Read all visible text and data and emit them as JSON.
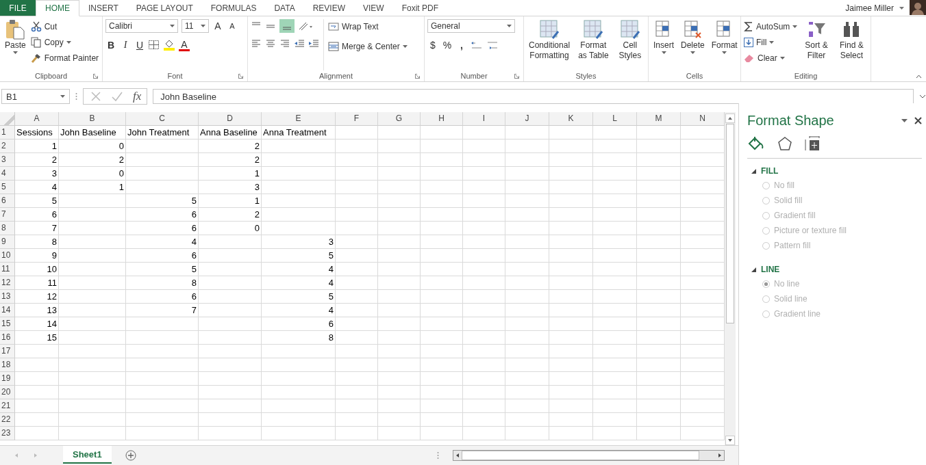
{
  "tabs": [
    {
      "label": "FILE",
      "kind": "file"
    },
    {
      "label": "HOME",
      "kind": "tab",
      "selected": true
    },
    {
      "label": "INSERT",
      "kind": "tab",
      "selected": false
    },
    {
      "label": "PAGE LAYOUT",
      "kind": "tab",
      "selected": false
    },
    {
      "label": "FORMULAS",
      "kind": "tab",
      "selected": false
    },
    {
      "label": "DATA",
      "kind": "tab",
      "selected": false
    },
    {
      "label": "REVIEW",
      "kind": "tab",
      "selected": false
    },
    {
      "label": "VIEW",
      "kind": "tab",
      "selected": false
    },
    {
      "label": "Foxit PDF",
      "kind": "tab",
      "selected": false
    }
  ],
  "user": "Jaimee Miller",
  "ribbon": {
    "clipboard": {
      "label": "Clipboard",
      "paste": "Paste",
      "cut": "Cut",
      "copy": "Copy",
      "format_painter": "Format Painter"
    },
    "font": {
      "label": "Font",
      "family": "Calibri",
      "size": "11",
      "grow": "A",
      "shrink": "A",
      "bold": "B",
      "italic": "I",
      "underline": "U",
      "font_color_letter": "A"
    },
    "alignment": {
      "label": "Alignment",
      "wrap": "Wrap Text",
      "merge": "Merge & Center"
    },
    "number": {
      "label": "Number",
      "format": "General",
      "currency": "$",
      "percent": "%",
      "comma": ","
    },
    "styles": {
      "label": "Styles",
      "buttons": [
        "Conditional Formatting",
        "Format as Table",
        "Cell Styles"
      ]
    },
    "cells": {
      "label": "Cells",
      "buttons": [
        "Insert",
        "Delete",
        "Format"
      ]
    },
    "editing": {
      "label": "Editing",
      "autosum": "AutoSum",
      "fill": "Fill",
      "clear": "Clear",
      "buttons": [
        "Sort & Filter",
        "Find & Select"
      ]
    }
  },
  "formula_bar": {
    "name_box": "B1",
    "fx": "fx",
    "content": "John Baseline"
  },
  "sheet": {
    "columns": [
      "A",
      "B",
      "C",
      "D",
      "E",
      "F",
      "G",
      "H",
      "I",
      "J",
      "K",
      "L",
      "M",
      "N"
    ],
    "rows": [
      {
        "number": "1",
        "cells": [
          "Sessions",
          "John Baseline",
          "John Treatment",
          "Anna Baseline",
          "Anna Treatment"
        ]
      },
      {
        "number": "2",
        "cells": [
          "1",
          "0",
          null,
          "2"
        ]
      },
      {
        "number": "3",
        "cells": [
          "2",
          "2",
          null,
          "2"
        ]
      },
      {
        "number": "4",
        "cells": [
          "3",
          "0",
          null,
          "1"
        ]
      },
      {
        "number": "5",
        "cells": [
          "4",
          "1",
          null,
          "3"
        ]
      },
      {
        "number": "6",
        "cells": [
          "5",
          null,
          "5",
          "1"
        ]
      },
      {
        "number": "7",
        "cells": [
          "6",
          null,
          "6",
          "2"
        ]
      },
      {
        "number": "8",
        "cells": [
          "7",
          null,
          "6",
          "0"
        ]
      },
      {
        "number": "9",
        "cells": [
          "8",
          null,
          "4",
          null,
          "3"
        ]
      },
      {
        "number": "10",
        "cells": [
          "9",
          null,
          "6",
          null,
          "5"
        ]
      },
      {
        "number": "11",
        "cells": [
          "10",
          null,
          "5",
          null,
          "4"
        ]
      },
      {
        "number": "12",
        "cells": [
          "11",
          null,
          "8",
          null,
          "4"
        ]
      },
      {
        "number": "13",
        "cells": [
          "12",
          null,
          "6",
          null,
          "5"
        ]
      },
      {
        "number": "14",
        "cells": [
          "13",
          null,
          "7",
          null,
          "4"
        ]
      },
      {
        "number": "15",
        "cells": [
          "14",
          null,
          null,
          null,
          "6"
        ]
      },
      {
        "number": "16",
        "cells": [
          "15",
          null,
          null,
          null,
          "8"
        ]
      },
      {
        "number": "17",
        "cells": []
      },
      {
        "number": "18",
        "cells": []
      },
      {
        "number": "19",
        "cells": []
      },
      {
        "number": "20",
        "cells": []
      },
      {
        "number": "21",
        "cells": []
      },
      {
        "number": "22",
        "cells": []
      },
      {
        "number": "23",
        "cells": []
      }
    ]
  },
  "sheet_tabs": [
    {
      "label": "Sheet1",
      "selected": true
    }
  ],
  "panel": {
    "title": "Format Shape",
    "icon_tabs": [
      {
        "kind": "fill",
        "selected": true
      },
      {
        "kind": "effects",
        "selected": false
      },
      {
        "kind": "size",
        "selected": false
      }
    ],
    "sections": [
      {
        "title": "FILL",
        "expanded": true,
        "options": [
          {
            "label": "No fill",
            "selected": false,
            "disabled": true
          },
          {
            "label": "Solid fill",
            "selected": false,
            "disabled": true
          },
          {
            "label": "Gradient fill",
            "selected": false,
            "disabled": true
          },
          {
            "label": "Picture or texture fill",
            "selected": false,
            "disabled": true
          },
          {
            "label": "Pattern fill",
            "selected": false,
            "disabled": true
          }
        ]
      },
      {
        "title": "LINE",
        "expanded": true,
        "options": [
          {
            "label": "No line",
            "selected": true,
            "disabled": true
          },
          {
            "label": "Solid line",
            "selected": false,
            "disabled": true
          },
          {
            "label": "Gradient line",
            "selected": false,
            "disabled": true
          }
        ]
      }
    ]
  }
}
